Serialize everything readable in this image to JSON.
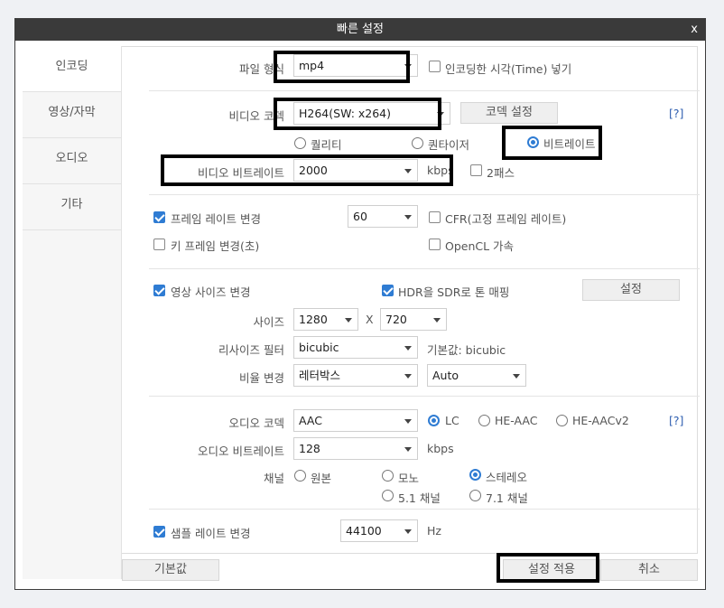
{
  "window": {
    "title": "빠른 설정",
    "close_label": "x"
  },
  "sidebar": {
    "items": [
      {
        "label": "인코딩"
      },
      {
        "label": "영상/자막"
      },
      {
        "label": "오디오"
      },
      {
        "label": "기타"
      }
    ]
  },
  "file_format": {
    "label": "파일 형식",
    "value": "mp4",
    "timestamp_checkbox": "인코딩한 시각(Time) 넣기"
  },
  "video": {
    "codec_label": "비디오 코덱",
    "codec_value": "H264(SW: x264)",
    "codec_settings_button": "코덱 설정",
    "help": "[?]",
    "modes": [
      "퀄리티",
      "퀀타이저",
      "비트레이트"
    ],
    "bitrate_label": "비디오 비트레이트",
    "bitrate_value": "2000",
    "bitrate_unit": "kbps",
    "two_pass": "2패스"
  },
  "framerate": {
    "change_label": "프레임 레이트 변경",
    "fps_value": "60",
    "cfr_label": "CFR(고정 프레임 레이트)",
    "keyframe_label": "키 프레임 변경(초)",
    "opencl_label": "OpenCL 가속"
  },
  "resize": {
    "change_label": "영상 사이즈 변경",
    "hdr_label": "HDR을 SDR로 톤 매핑",
    "hdr_settings_button": "설정",
    "size_label": "사이즈",
    "width": "1280",
    "times": "X",
    "height": "720",
    "filter_label": "리사이즈 필터",
    "filter_value": "bicubic",
    "filter_default": "기본값: bicubic",
    "ratio_label": "비율 변경",
    "ratio_value": "레터박스",
    "ratio_mode": "Auto"
  },
  "audio": {
    "codec_label": "오디오 코덱",
    "codec_value": "AAC",
    "profiles": [
      "LC",
      "HE-AAC",
      "HE-AACv2"
    ],
    "help": "[?]",
    "bitrate_label": "오디오 비트레이트",
    "bitrate_value": "128",
    "bitrate_unit": "kbps",
    "channel_label": "채널",
    "channels": [
      "원본",
      "모노",
      "스테레오",
      "5.1 채널",
      "7.1 채널"
    ]
  },
  "samplerate": {
    "change_label": "샘플 레이트 변경",
    "value": "44100",
    "unit": "Hz"
  },
  "footer": {
    "default_button": "기본값",
    "apply_button": "설정 적용",
    "cancel_button": "취소"
  }
}
